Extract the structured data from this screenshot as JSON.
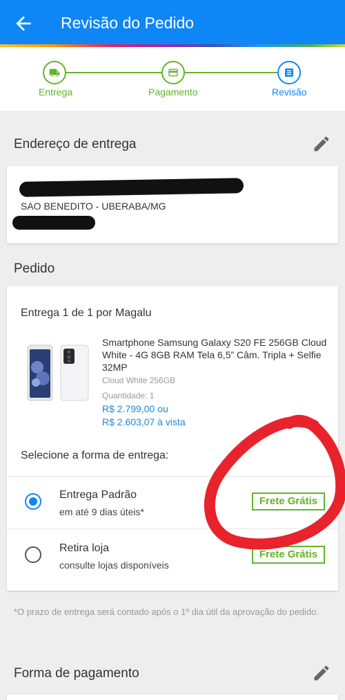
{
  "header": {
    "title": "Revisão do Pedido"
  },
  "steps": [
    {
      "label": "Entrega",
      "icon": "truck-icon",
      "state": "done"
    },
    {
      "label": "Pagamento",
      "icon": "card-icon",
      "state": "done"
    },
    {
      "label": "Revisão",
      "icon": "list-icon",
      "state": "current"
    }
  ],
  "address_section": {
    "title": "Endereço de entrega",
    "city_line": "SAO BENEDITO - UBERABA/MG"
  },
  "order_section": {
    "title": "Pedido",
    "delivery_title": "Entrega 1 de 1 por Magalu",
    "product": {
      "name": "Smartphone Samsung Galaxy S20 FE 256GB Cloud White - 4G 8GB RAM Tela 6,5” Câm. Tripla + Selfie 32MP",
      "variant": "Cloud White 256GB",
      "quantity": "Quantidade:  1",
      "price": "R$ 2.799,00 ou",
      "price_cash": "R$ 2.603,07 à vista"
    },
    "select_label": "Selecione a forma de entrega:",
    "options": [
      {
        "title": "Entrega Padrão",
        "subtitle": "em até 9 dias úteis*",
        "badge": "Frete Grátis",
        "selected": true
      },
      {
        "title": "Retira loja",
        "subtitle": "consulte lojas disponíveis",
        "badge": "Frete Grátis",
        "selected": false
      }
    ]
  },
  "note": "*O prazo de entrega será contado após o 1º dia útil da aprovação do pedido.",
  "payment_section": {
    "title": "Forma de pagamento"
  },
  "colors": {
    "primary": "#0f86f5",
    "success": "#62b32a",
    "price": "#1a8ad8",
    "annotation": "#e8232b"
  }
}
